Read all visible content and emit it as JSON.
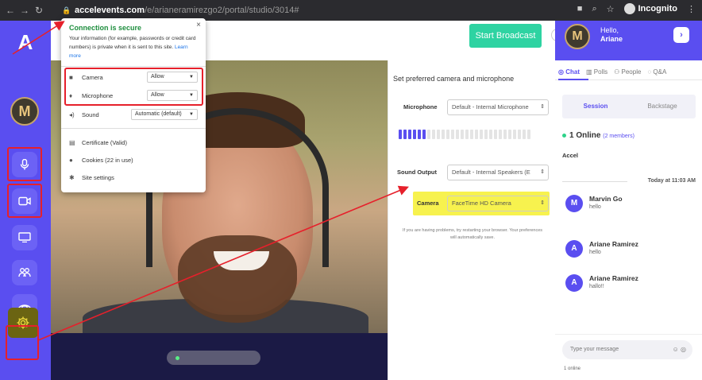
{
  "browser": {
    "url_host": "accelevents.com",
    "url_path": "/e/arianeramirezgo2/portal/studio/3014#",
    "profile": "Incognito"
  },
  "popup": {
    "title": "Connection is secure",
    "close": "×",
    "description": "Your information (for example, passwords or credit card numbers) is private when it is sent to this site.",
    "learn_more": "Learn more",
    "rows": [
      {
        "label": "Camera",
        "value": "Allow",
        "icon": "camera-icon"
      },
      {
        "label": "Microphone",
        "value": "Allow",
        "icon": "microphone-icon"
      },
      {
        "label": "Sound",
        "value": "Automatic (default)",
        "icon": "speaker-icon"
      }
    ],
    "links": [
      {
        "label": "Certificate (Valid)",
        "icon": "certificate-icon"
      },
      {
        "label": "Cookies (22 in use)",
        "icon": "cookie-icon"
      },
      {
        "label": "Site settings",
        "icon": "gear-icon"
      }
    ]
  },
  "topbar": {
    "start_broadcast": "Start Broadcast"
  },
  "settings_panel": {
    "title": "Set preferred camera and microphone",
    "microphone_label": "Microphone",
    "microphone_value": "Default - Internal Microphone",
    "sound_output_label": "Sound Output",
    "sound_output_value": "Default - Internal Speakers (E",
    "camera_label": "Camera",
    "camera_value": "FaceTime HD Camera",
    "help_text": "If you are having problems, try restarting your browser. Your preferences will automatically save.",
    "mic_level": 0.2
  },
  "rail": {
    "logo": "A",
    "avatar_initial": "M"
  },
  "chat": {
    "hello": "Hello,",
    "user": "Ariane",
    "avatar_initial": "M",
    "tabs": [
      {
        "label": "Chat",
        "active": true
      },
      {
        "label": "Polls",
        "active": false
      },
      {
        "label": "People",
        "active": false
      },
      {
        "label": "Q&A",
        "active": false
      }
    ],
    "subtab_session": "Session",
    "subtab_backstage": "Backstage",
    "online_count": "1 Online",
    "online_members": "(2 members)",
    "org": "Accel",
    "date": "Today at 11:03 AM",
    "messages": [
      {
        "initial": "M",
        "name": "Marvin Go",
        "text": "hello"
      },
      {
        "initial": "A",
        "name": "Ariane Ramirez",
        "text": "hello"
      },
      {
        "initial": "A",
        "name": "Ariane Ramirez",
        "text": "hallo!!"
      }
    ],
    "input_placeholder": "Type your message",
    "footer": "1 online"
  },
  "colors": {
    "brand": "#5a4ef0",
    "broadcast": "#2ed3a2",
    "annotation": "#e6202b",
    "highlight": "#f7f24e"
  }
}
